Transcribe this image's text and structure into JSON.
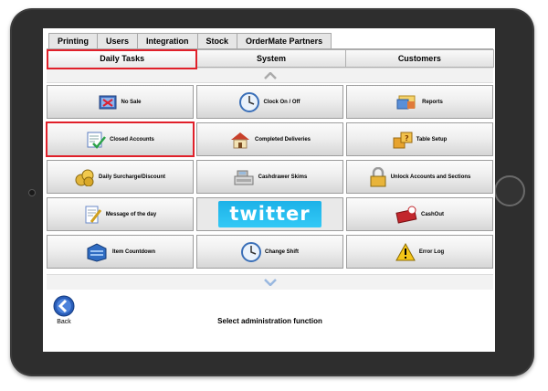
{
  "top_tabs": [
    "Printing",
    "Users",
    "Integration",
    "Stock",
    "OrderMate Partners"
  ],
  "sub_tabs": [
    {
      "label": "Daily Tasks",
      "active": true
    },
    {
      "label": "System",
      "active": false
    },
    {
      "label": "Customers",
      "active": false
    }
  ],
  "tiles": {
    "no_sale": "No Sale",
    "clock_on_off": "Clock On / Off",
    "reports": "Reports",
    "closed_accounts": "Closed Accounts",
    "completed_deliveries": "Completed Deliveries",
    "table_setup": "Table Setup",
    "daily_surcharge": "Daily Surcharge/Discount",
    "cashdrawer_skims": "Cashdrawer Skims",
    "unlock_accounts": "Unlock Accounts and Sections",
    "message_of_day": "Message of the day",
    "twitter": "twitter",
    "cashout": "CashOut",
    "item_countdown": "Item Countdown",
    "change_shift": "Change Shift",
    "error_log": "Error Log"
  },
  "footer": {
    "back_label": "Back",
    "status": "Select administration function"
  },
  "colors": {
    "highlight": "#e0202a",
    "twitter": "#1db2e8",
    "back_icon": "#2a5db8"
  }
}
